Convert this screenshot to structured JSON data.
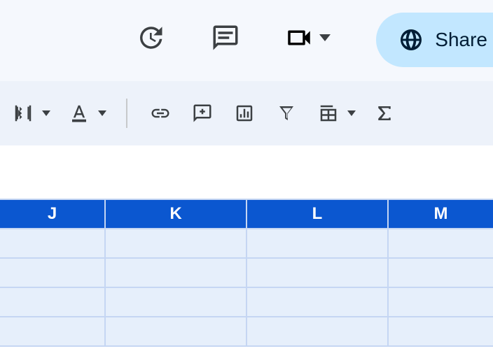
{
  "topbar": {
    "share_label": "Share"
  },
  "columns": [
    "J",
    "K",
    "L",
    "M"
  ],
  "rows": [
    [
      "",
      "",
      "",
      ""
    ],
    [
      "",
      "",
      "",
      ""
    ],
    [
      "",
      "",
      "",
      ""
    ],
    [
      "",
      "",
      "",
      ""
    ]
  ]
}
